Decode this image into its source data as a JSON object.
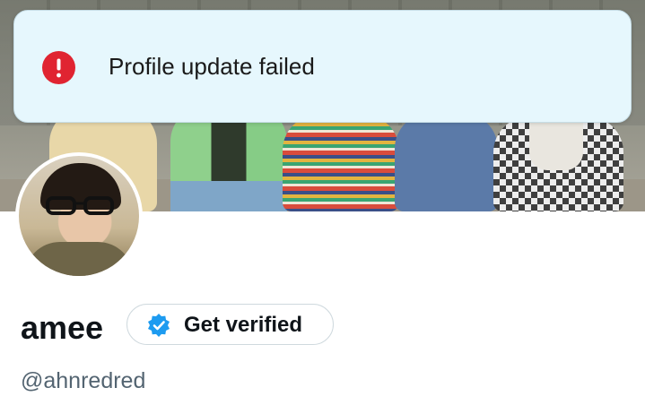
{
  "toast": {
    "message": "Profile update failed",
    "status_color": "#e02431",
    "icon": "error-icon"
  },
  "profile": {
    "display_name": "amee",
    "handle": "@ahnredred",
    "verify_button_label": "Get verified",
    "verify_icon": "verified-badge-icon",
    "accent_color": "#1d9bf0"
  }
}
